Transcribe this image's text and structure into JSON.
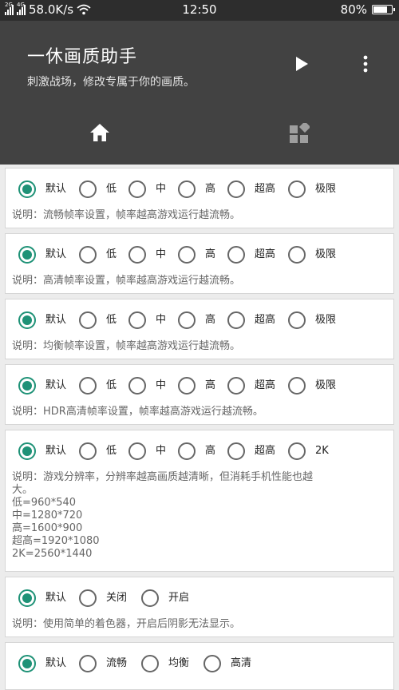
{
  "status_bar": {
    "net_tag_1": "2G",
    "net_tag_2": "4G",
    "speed": "58.0K/s",
    "time": "12:50",
    "battery": "80%",
    "battery_level": 0.8
  },
  "app_bar": {
    "title": "一休画质助手",
    "subtitle": "刺激战场，修改专属于你的画质。",
    "icons": [
      "play-icon",
      "more-vert-icon"
    ]
  },
  "tabs": [
    {
      "icon": "home-icon",
      "selected": true
    },
    {
      "icon": "apps-icon",
      "selected": false
    }
  ],
  "settings": [
    {
      "options": [
        "默认",
        "低",
        "中",
        "高",
        "超高",
        "极限"
      ],
      "selected": 0,
      "description": "说明：流畅帧率设置，帧率越高游戏运行越流畅。"
    },
    {
      "options": [
        "默认",
        "低",
        "中",
        "高",
        "超高",
        "极限"
      ],
      "selected": 0,
      "description": "说明：高清帧率设置，帧率越高游戏运行越流畅。"
    },
    {
      "options": [
        "默认",
        "低",
        "中",
        "高",
        "超高",
        "极限"
      ],
      "selected": 0,
      "description": "说明：均衡帧率设置，帧率越高游戏运行越流畅。"
    },
    {
      "options": [
        "默认",
        "低",
        "中",
        "高",
        "超高",
        "极限"
      ],
      "selected": 0,
      "description": "说明：HDR高清帧率设置，帧率越高游戏运行越流畅。"
    },
    {
      "options": [
        "默认",
        "低",
        "中",
        "高",
        "超高",
        "2K"
      ],
      "selected": 0,
      "description": "说明：游戏分辨率，分辨率越高画质越清晰，但消耗手机性能也越\n大。\n低=960*540\n中=1280*720\n高=1600*900\n超高=1920*1080\n2K=2560*1440"
    },
    {
      "options": [
        "默认",
        "关闭",
        "开启"
      ],
      "selected": 0,
      "description": "说明：使用简单的着色器，开启后阴影无法显示。"
    },
    {
      "options": [
        "默认",
        "流畅",
        "均衡",
        "高清"
      ],
      "selected": 0,
      "description": ""
    }
  ],
  "colors": {
    "app_bar": "#424242",
    "status_bar": "#2d2d2d",
    "accent": "#1f9277",
    "background": "#ececec"
  }
}
